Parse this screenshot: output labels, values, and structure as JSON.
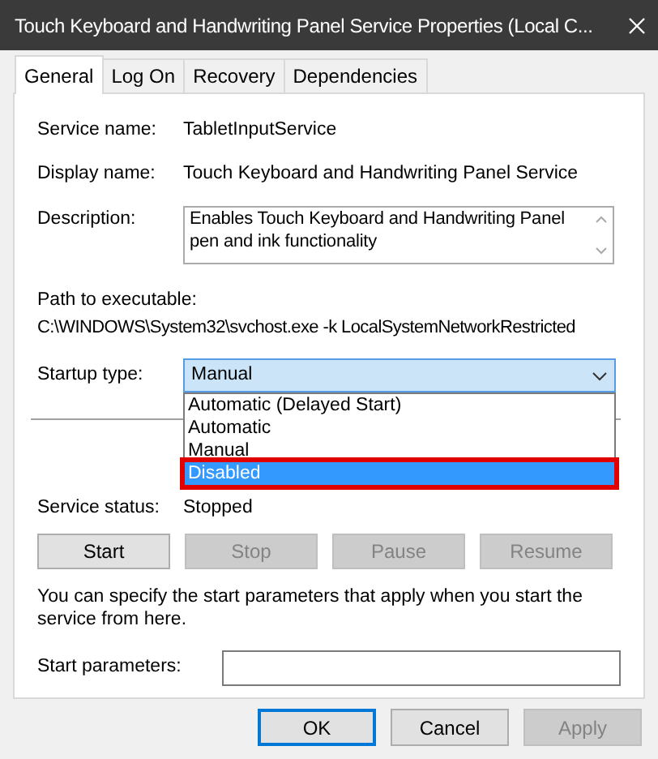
{
  "window": {
    "title": "Touch Keyboard and Handwriting Panel Service Properties (Local C..."
  },
  "tabs": [
    {
      "label": "General",
      "selected": true
    },
    {
      "label": "Log On",
      "selected": false
    },
    {
      "label": "Recovery",
      "selected": false
    },
    {
      "label": "Dependencies",
      "selected": false
    }
  ],
  "service_name": {
    "label": "Service name:",
    "value": "TabletInputService"
  },
  "display_name": {
    "label": "Display name:",
    "value": "Touch Keyboard and Handwriting Panel Service"
  },
  "description": {
    "label": "Description:",
    "value": "Enables Touch Keyboard and Handwriting Panel pen and ink functionality"
  },
  "path": {
    "label": "Path to executable:",
    "value": "C:\\WINDOWS\\System32\\svchost.exe -k LocalSystemNetworkRestricted"
  },
  "startup_type": {
    "label": "Startup type:",
    "value": "Manual",
    "expanded": true,
    "options": [
      {
        "label": "Automatic (Delayed Start)",
        "highlighted": false,
        "outlined": false
      },
      {
        "label": "Automatic",
        "highlighted": false,
        "outlined": false
      },
      {
        "label": "Manual",
        "highlighted": false,
        "outlined": false
      },
      {
        "label": "Disabled",
        "highlighted": true,
        "outlined": true
      }
    ]
  },
  "service_status": {
    "label": "Service status:",
    "value": "Stopped"
  },
  "service_buttons": [
    {
      "label": "Start",
      "disabled": false
    },
    {
      "label": "Stop",
      "disabled": true
    },
    {
      "label": "Pause",
      "disabled": true
    },
    {
      "label": "Resume",
      "disabled": true
    }
  ],
  "hint": "You can specify the start parameters that apply when you start the service from here.",
  "start_parameters": {
    "label": "Start parameters:"
  },
  "dialog_buttons": [
    {
      "label": "OK",
      "disabled": false,
      "default": true
    },
    {
      "label": "Cancel",
      "disabled": false,
      "default": false
    },
    {
      "label": "Apply",
      "disabled": true,
      "default": false
    }
  ]
}
